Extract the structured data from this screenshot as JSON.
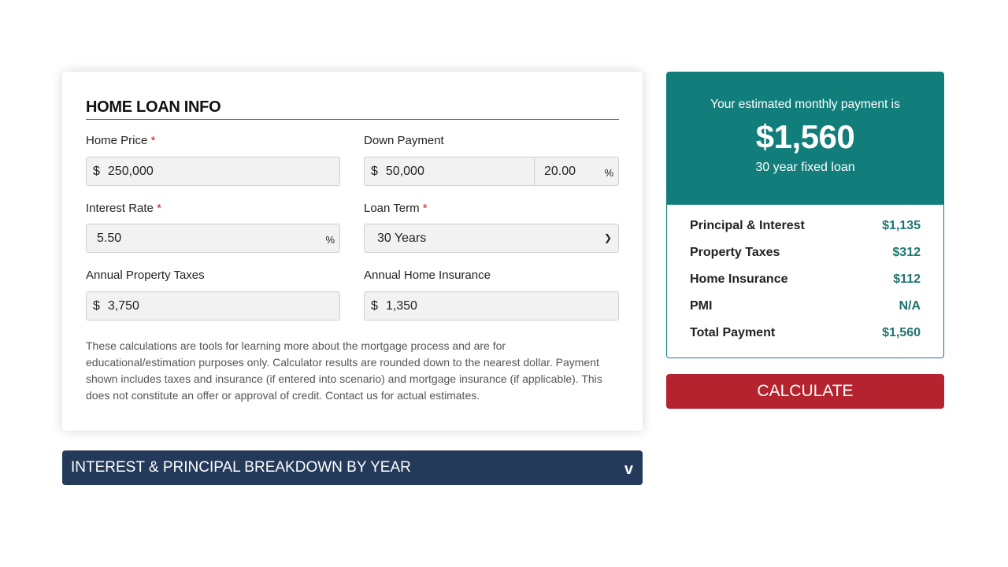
{
  "form": {
    "title": "HOME LOAN INFO",
    "home_price": {
      "label": "Home Price",
      "required": "*",
      "currency": "$",
      "value": "250,000"
    },
    "down_payment": {
      "label": "Down Payment",
      "currency": "$",
      "value": "50,000",
      "percent": "20.00",
      "percent_sign": "%"
    },
    "interest_rate": {
      "label": "Interest Rate",
      "required": "*",
      "value": "5.50",
      "percent_sign": "%"
    },
    "loan_term": {
      "label": "Loan Term",
      "required": "*",
      "selected": "30 Years"
    },
    "property_taxes": {
      "label": "Annual Property Taxes",
      "currency": "$",
      "value": "3,750"
    },
    "home_insurance": {
      "label": "Annual Home Insurance",
      "currency": "$",
      "value": "1,350"
    },
    "disclaimer": "These calculations are tools for learning more about the mortgage process and are for educational/estimation purposes only. Calculator results are rounded down to the nearest dollar. Payment shown includes taxes and insurance (if entered into scenario) and mortgage insurance (if applicable). This does not constitute an offer or approval of credit. Contact us for actual estimates."
  },
  "result": {
    "intro": "Your estimated monthly payment is",
    "amount": "$1,560",
    "loan_type": "30 year fixed loan",
    "rows": [
      {
        "label": "Principal & Interest",
        "value": "$1,135"
      },
      {
        "label": "Property Taxes",
        "value": "$312"
      },
      {
        "label": "Home Insurance",
        "value": "$112"
      },
      {
        "label": "PMI",
        "value": "N/A"
      },
      {
        "label": "Total Payment",
        "value": "$1,560"
      }
    ]
  },
  "calculate_label": "CALCULATE",
  "accordion": {
    "label": "INTEREST & PRINCIPAL BREAKDOWN BY YEAR",
    "toggle": "v"
  },
  "colors": {
    "teal": "#127e7b",
    "red": "#b5232e",
    "navy": "#243a5a"
  }
}
